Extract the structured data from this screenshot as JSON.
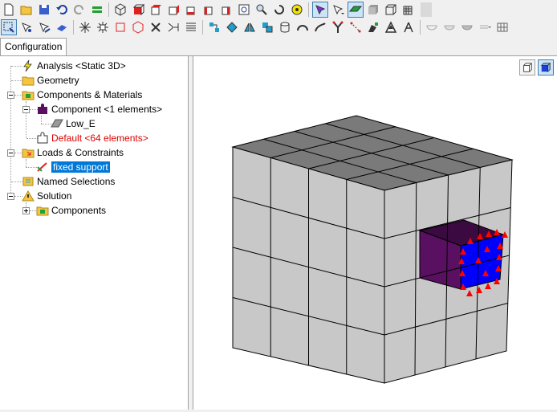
{
  "toolbar_top": {
    "icons": [
      "new-file-icon",
      "open-folder-icon",
      "save-icon",
      "undo-icon",
      "redo-icon",
      "equals-icon",
      "iso-view-icon",
      "front-view-icon",
      "back-view-icon",
      "top-view-icon",
      "bottom-view-icon",
      "left-view-icon",
      "right-view-icon",
      "zoom-fit-icon",
      "zoom-icon",
      "rotate-icon",
      "zoom-area-icon",
      "select-mode-icon",
      "pointer-dropdown-icon",
      "shaded-icon",
      "solid-icon",
      "wireframe-icon",
      "mesh-icon"
    ]
  },
  "toolbar_second": {
    "icons": [
      "select-box-icon",
      "select-point-icon",
      "select-edge-icon",
      "select-face-icon",
      "star-node-icon",
      "star-node-alt-icon",
      "rectangle-icon",
      "cube-outline-icon",
      "close-x-icon",
      "split-icon",
      "list-icon",
      "node-select-icon",
      "element-select-icon",
      "mirror-icon",
      "duplicate-icon",
      "cylinder-icon",
      "arc-icon",
      "sweep-icon",
      "fork-icon",
      "trim-icon",
      "paint-icon",
      "triangle-icon",
      "compass-icon",
      "bowl-icon",
      "bowl-alt-icon",
      "bowl-filled-icon",
      "dropdown-icon",
      "grid-icon"
    ]
  },
  "tabs": {
    "configuration": "Configuration"
  },
  "tree": {
    "analysis": "Analysis <Static 3D>",
    "geometry": "Geometry",
    "components_materials": "Components & Materials",
    "component": "Component <1 elements>",
    "low_e": "Low_E",
    "default": "Default <64 elements>",
    "loads_constraints": "Loads & Constraints",
    "fixed_support": "fixed support",
    "named_selections": "Named Selections",
    "solution": "Solution",
    "components": "Components"
  },
  "colors": {
    "mesh_front": "#c8c8c8",
    "mesh_top": "#7a7a7a",
    "selected_face": "#0000ff",
    "selected_side": "#5a1060",
    "constraint_arrow": "#ff0000",
    "selection_highlight": "#0078d7",
    "error_text": "#e00000"
  }
}
